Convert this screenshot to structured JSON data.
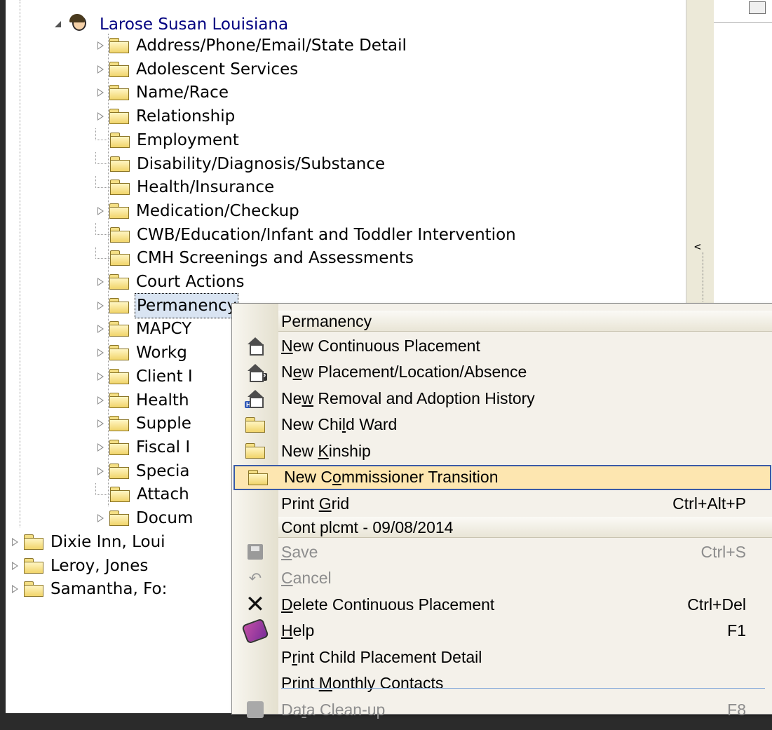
{
  "tree": {
    "root": {
      "label": "Larose Susan Louisiana"
    },
    "children": [
      {
        "label": "Address/Phone/Email/State Detail",
        "expandable": true
      },
      {
        "label": "Adolescent Services",
        "expandable": true
      },
      {
        "label": "Name/Race",
        "expandable": true
      },
      {
        "label": "Relationship",
        "expandable": true
      },
      {
        "label": "Employment",
        "expandable": false
      },
      {
        "label": "Disability/Diagnosis/Substance",
        "expandable": false
      },
      {
        "label": "Health/Insurance",
        "expandable": false
      },
      {
        "label": "Medication/Checkup",
        "expandable": true
      },
      {
        "label": "CWB/Education/Infant and Toddler Intervention",
        "expandable": false
      },
      {
        "label": "CMH Screenings and Assessments",
        "expandable": false
      },
      {
        "label": "Court Actions",
        "expandable": true
      },
      {
        "label": "Permanency",
        "expandable": true,
        "selected": true
      },
      {
        "label": "MAPCY",
        "expandable": true
      },
      {
        "label": "Workg",
        "expandable": true
      },
      {
        "label": "Client I",
        "expandable": true
      },
      {
        "label": "Health",
        "expandable": true
      },
      {
        "label": "Supple",
        "expandable": true
      },
      {
        "label": "Fiscal I",
        "expandable": true
      },
      {
        "label": "Specia",
        "expandable": true
      },
      {
        "label": "Attach",
        "expandable": false
      },
      {
        "label": "Docum",
        "expandable": true
      }
    ],
    "siblings": [
      {
        "label": "Dixie Inn, Loui"
      },
      {
        "label": "Leroy, Jones"
      },
      {
        "label": "Samantha, Fo:"
      }
    ]
  },
  "menu": {
    "header1": "Permanency",
    "group1": [
      {
        "pre": "",
        "u": "N",
        "post": "ew Continuous Placement",
        "shortcut": "",
        "icon": "house-icon"
      },
      {
        "pre": "N",
        "u": "e",
        "post": "w Placement/Location/Absence",
        "shortcut": "",
        "icon": "house-p-icon"
      },
      {
        "pre": "Ne",
        "u": "w",
        "post": " Removal and Adoption History",
        "shortcut": "",
        "icon": "house-hist-icon"
      },
      {
        "pre": "New Chi",
        "u": "l",
        "post": "d Ward",
        "shortcut": "",
        "icon": "folder-icon"
      },
      {
        "pre": "New ",
        "u": "K",
        "post": "inship",
        "shortcut": "",
        "icon": "folder-icon"
      },
      {
        "pre": "New C",
        "u": "o",
        "post": "mmissioner Transition",
        "shortcut": "",
        "icon": "folder-icon",
        "highlight": true
      },
      {
        "pre": "Print ",
        "u": "G",
        "post": "rid",
        "shortcut": "Ctrl+Alt+P",
        "icon": ""
      }
    ],
    "header2": "Cont plcmt - 09/08/2014",
    "group2": [
      {
        "pre": "",
        "u": "S",
        "post": "ave",
        "shortcut": "Ctrl+S",
        "icon": "save-icon",
        "disabled": true
      },
      {
        "pre": "",
        "u": "C",
        "post": "ancel",
        "shortcut": "",
        "icon": "undo-icon",
        "disabled": true
      },
      {
        "pre": "",
        "u": "D",
        "post": "elete Continuous Placement",
        "shortcut": "Ctrl+Del",
        "icon": "delete-icon"
      },
      {
        "pre": "",
        "u": "H",
        "post": "elp",
        "shortcut": "F1",
        "icon": "help-book-icon"
      },
      {
        "pre": "P",
        "u": "r",
        "post": "int Child Placement Detail",
        "shortcut": "",
        "icon": ""
      },
      {
        "pre": "Print ",
        "u": "M",
        "post": "onthly Contacts",
        "shortcut": "",
        "icon": ""
      },
      {
        "pre": "Da",
        "u": "t",
        "post": "a Clean-up",
        "shortcut": "F8",
        "icon": "clean-up-icon",
        "disabled": true
      }
    ]
  }
}
